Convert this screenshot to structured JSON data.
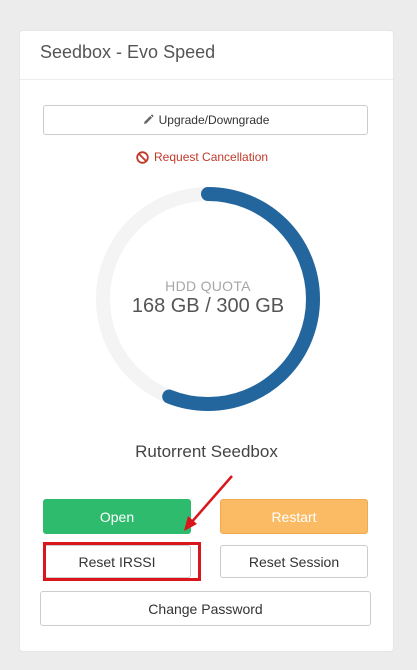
{
  "panel": {
    "title": "Seedbox - Evo Speed"
  },
  "actions": {
    "upgrade_label": "Upgrade/Downgrade",
    "cancel_label": "Request Cancellation"
  },
  "quota": {
    "label": "HDD QUOTA",
    "value_text": "168 GB / 300 GB",
    "used_gb": 168,
    "total_gb": 300,
    "fill_fraction": 0.56,
    "colors": {
      "fill": "#23669e",
      "track": "#f4f4f4"
    }
  },
  "service": {
    "name": "Rutorrent Seedbox"
  },
  "buttons": {
    "open": "Open",
    "restart": "Restart",
    "reset_irssi": "Reset IRSSI",
    "reset_session": "Reset Session",
    "change_password": "Change Password"
  },
  "icons": {
    "upgrade": "pencil-icon",
    "cancel": "ban-icon"
  },
  "colors": {
    "open": "#2ebb6e",
    "restart": "#fbbb64",
    "cancel_text": "#c0392b",
    "annotation": "#d9161c"
  }
}
